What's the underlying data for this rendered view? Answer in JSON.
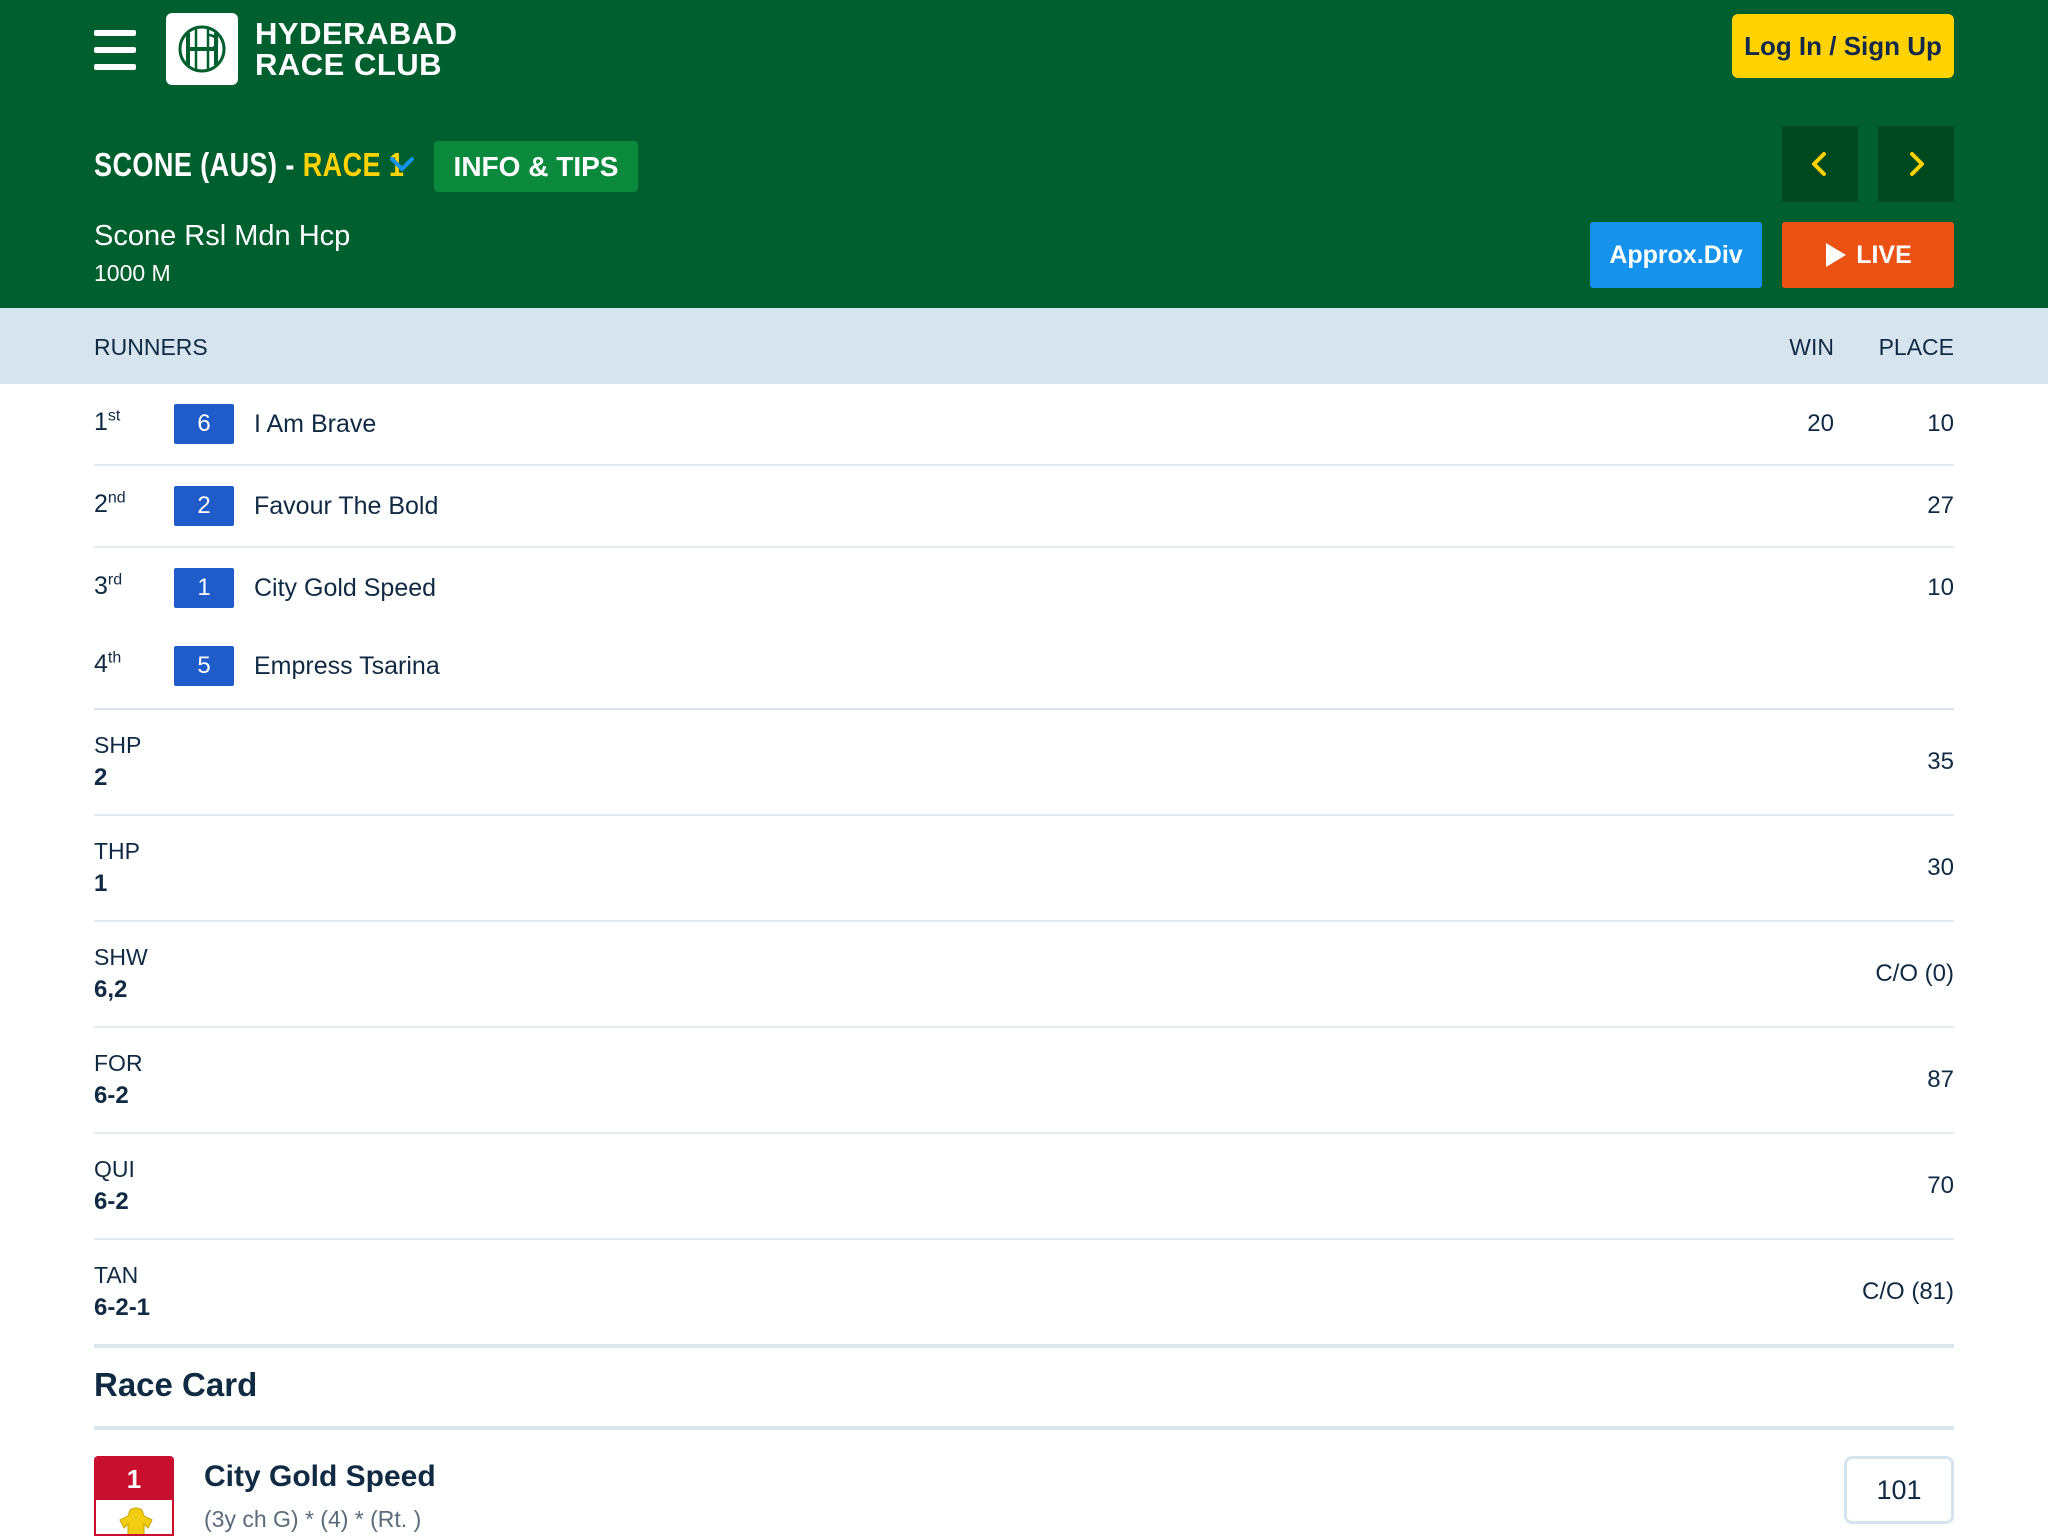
{
  "header": {
    "logo_line1": "HYDERABAD",
    "logo_line2": "RACE CLUB",
    "login_label": "Log In / Sign Up",
    "race_title_prefix": "SCONE (AUS) - ",
    "race_title_race": "RACE 1",
    "info_tips_label": "INFO & TIPS",
    "race_name": "Scone Rsl Mdn Hcp",
    "race_distance": "1000 M",
    "approx_div_label": "Approx.Div",
    "live_label": "LIVE"
  },
  "table": {
    "col_runners": "RUNNERS",
    "col_win": "WIN",
    "col_place": "PLACE"
  },
  "runners": [
    {
      "pos": "1",
      "suffix": "st",
      "number": "6",
      "name": "I Am Brave",
      "win": "20",
      "place": "10"
    },
    {
      "pos": "2",
      "suffix": "nd",
      "number": "2",
      "name": "Favour The Bold",
      "win": "",
      "place": "27"
    },
    {
      "pos": "3",
      "suffix": "rd",
      "number": "1",
      "name": "City Gold Speed",
      "win": "",
      "place": "10"
    },
    {
      "pos": "4",
      "suffix": "th",
      "number": "5",
      "name": "Empress Tsarina",
      "win": "",
      "place": ""
    }
  ],
  "pools": [
    {
      "type": "SHP",
      "combination": "2",
      "dividend": "35"
    },
    {
      "type": "THP",
      "combination": "1",
      "dividend": "30"
    },
    {
      "type": "SHW",
      "combination": "6,2",
      "dividend": "C/O (0)"
    },
    {
      "type": "FOR",
      "combination": "6-2",
      "dividend": "87"
    },
    {
      "type": "QUI",
      "combination": "6-2",
      "dividend": "70"
    },
    {
      "type": "TAN",
      "combination": "6-2-1",
      "dividend": "C/O (81)"
    }
  ],
  "race_card": {
    "title": "Race Card",
    "entry": {
      "number": "1",
      "horse": "City Gold Speed",
      "info": "(3y ch G) * (4) * (Rt. )",
      "rating": "101"
    }
  },
  "colors": {
    "header_green": "#005f2f",
    "accent_yellow": "#ffd200",
    "badge_blue": "#1f5cc9",
    "approx_blue": "#1593ec",
    "live_orange": "#ea5113",
    "card_red": "#c8102e"
  },
  "icons": {
    "menu": "hamburger-icon",
    "logo": "hrc-monogram-icon",
    "race_dropdown": "chevron-down-icon",
    "prev": "chevron-left-icon",
    "next": "chevron-right-icon",
    "live": "play-icon",
    "silk": "jockey-silk-icon"
  }
}
